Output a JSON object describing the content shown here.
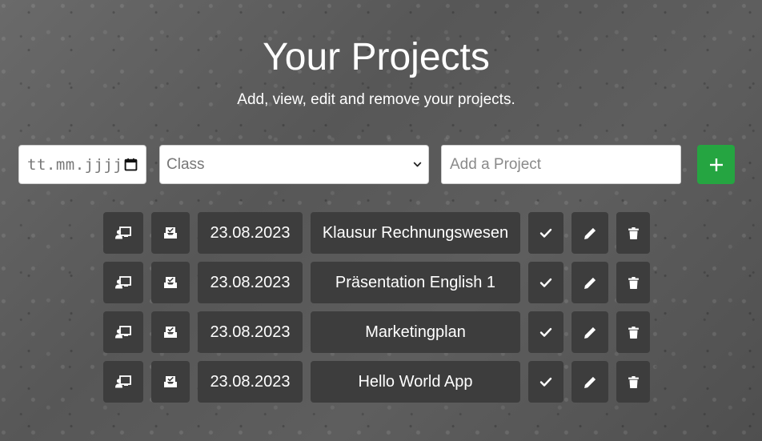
{
  "header": {
    "title": "Your Projects",
    "subtitle": "Add, view, edit and remove your projects."
  },
  "form": {
    "date_placeholder": "tt.mm.jjjj",
    "class_placeholder": "Class",
    "project_placeholder": "Add a Project",
    "add_icon": "plus-icon",
    "add_color": "#25a541"
  },
  "projects": [
    {
      "date": "23.08.2023",
      "name": "Klausur Rechnungswesen"
    },
    {
      "date": "23.08.2023",
      "name": "Präsentation English 1"
    },
    {
      "date": "23.08.2023",
      "name": "Marketingplan"
    },
    {
      "date": "23.08.2023",
      "name": "Hello World App"
    }
  ],
  "row_icons": [
    "chalkboard-teacher-icon",
    "inbox-check-icon",
    "check-icon",
    "pencil-icon",
    "trash-icon"
  ],
  "colors": {
    "cell_background": "#3d3d3d",
    "text": "#ffffff"
  }
}
